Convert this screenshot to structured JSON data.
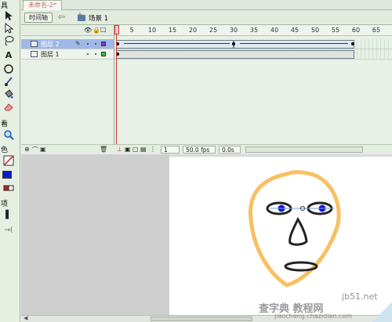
{
  "tools_panel": {
    "captions": [
      "具",
      "看",
      "色",
      "项"
    ],
    "icons": [
      "arrow-select-icon",
      "subselect-icon",
      "free-transform-icon",
      "lasso-icon",
      "text-icon",
      "oval-icon",
      "brush-icon",
      "paint-bucket-icon",
      "eraser-icon",
      "zoom-icon",
      "stroke-color-icon",
      "fill-color-icon",
      "swap-colors-icon",
      "snap-icon"
    ],
    "stroke_color": "#d21818",
    "fill_color": "#0a1ec8"
  },
  "document": {
    "tab_title": "未命名-2*",
    "timeline_button": "时间轴",
    "scene_label": "场景 1"
  },
  "timeline": {
    "ruler": [
      "5",
      "10",
      "15",
      "20",
      "25",
      "30",
      "35",
      "40",
      "45",
      "50",
      "55",
      "60",
      "65"
    ],
    "layers": [
      {
        "name": "图层 2",
        "selected": true,
        "color": "#7e3cc8"
      },
      {
        "name": "图层 1",
        "selected": false,
        "color": "#2fc43a"
      }
    ],
    "current_frame": "1",
    "fps": "50.0 fps",
    "elapsed": "0.0s"
  },
  "watermark": {
    "main": "查字典 教程网",
    "site": "jiaocheng.chazidian.com",
    "brand": "jb51.net"
  }
}
